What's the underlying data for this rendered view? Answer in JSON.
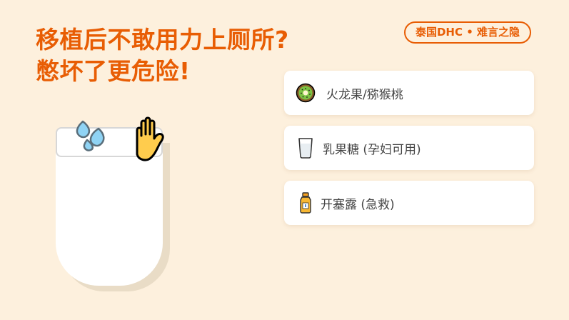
{
  "headline": {
    "line1": "移植后不敢用力上厕所?",
    "line2": "憋坏了更危险!"
  },
  "badge": {
    "label": "泰国DHC • 难言之隐"
  },
  "illustration": {
    "icons": [
      "sweat-droplets-icon",
      "raised-hand-icon"
    ]
  },
  "options": [
    {
      "label": "火龙果/猕猴桃",
      "icon": "kiwi-icon"
    },
    {
      "label": "乳果糖 (孕妇可用)",
      "icon": "milk-glass-icon"
    },
    {
      "label": "开塞露 (急救)",
      "icon": "medicine-bottle-icon"
    }
  ],
  "colors": {
    "accent": "#e85d04",
    "background": "#fdf0dd",
    "card": "#ffffff",
    "text": "#444444"
  }
}
